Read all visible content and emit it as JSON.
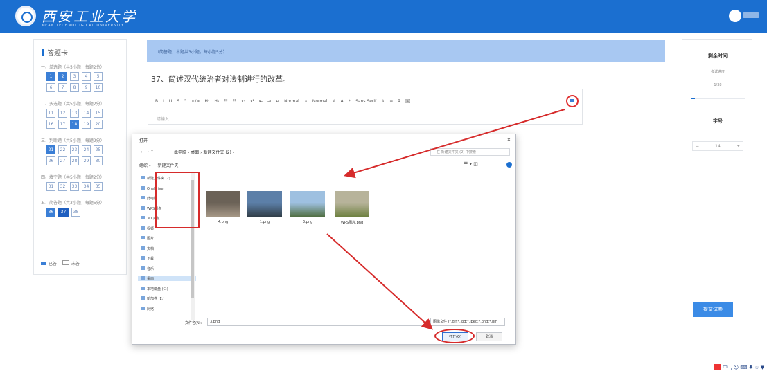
{
  "header": {
    "logo_text": "西安工业大学",
    "logo_sub": "XI'AN TECHNOLOGICAL UNIVERSITY",
    "user_name": ""
  },
  "answer_card": {
    "title": "答题卡",
    "sections": [
      {
        "title": "一、单选题（共5小题，每题2分）",
        "rows": [
          [
            "1",
            "2",
            "3",
            "4",
            "5"
          ],
          [
            "6",
            "7",
            "8",
            "9",
            "10"
          ]
        ],
        "done": [
          "1",
          "2"
        ],
        "current": []
      },
      {
        "title": "二、多选题（共5小题，每题2分）",
        "rows": [
          [
            "11",
            "12",
            "13",
            "14",
            "15"
          ],
          [
            "16",
            "17",
            "18",
            "19",
            "20"
          ]
        ],
        "done": [
          "18"
        ],
        "current": []
      },
      {
        "title": "三、判断题（共5小题，每题2分）",
        "rows": [
          [
            "21",
            "22",
            "23",
            "24",
            "25"
          ],
          [
            "26",
            "27",
            "28",
            "29",
            "30"
          ]
        ],
        "done": [
          "21"
        ],
        "current": []
      },
      {
        "title": "四、填空题（共5小题，每题2分）",
        "rows": [
          [
            "31",
            "32",
            "33",
            "34",
            "35"
          ]
        ],
        "done": [],
        "current": []
      },
      {
        "title": "五、简答题（共3小题，每题5分）",
        "rows": [
          [
            "36",
            "37",
            "38"
          ]
        ],
        "done": [
          "36"
        ],
        "current": [
          "37"
        ]
      }
    ],
    "legend_done": "已答",
    "legend_todo": "未答"
  },
  "main": {
    "banner_text": "（简答题，本题共3小题，每小题5分）",
    "question": "37、简述汉代统治者对法制进行的改革。",
    "toolbar_items": [
      "B",
      "I",
      "U",
      "S",
      "❞",
      "</>",
      "H₁",
      "H₂",
      "☷",
      "☷",
      "x₂",
      "x²",
      "⇤",
      "⇥",
      "↵",
      "Normal",
      "⇕",
      "Normal",
      "⇕",
      "A",
      "⌖",
      "Sans Serif",
      "⇕",
      "≡",
      "T̶",
      "🖼"
    ],
    "editor_placeholder": "请输入"
  },
  "right_panel": {
    "time_title": "剩余时间",
    "time_label": "考试进度",
    "time_value": "1/38",
    "progress_percent": 8,
    "font_title": "字号",
    "font_minus": "−",
    "font_value": "14",
    "font_plus": "+",
    "submit_label": "提交试卷"
  },
  "dialog": {
    "title": "打开",
    "close": "×",
    "nav_arrows": "← → ↑",
    "path": [
      "此电脑",
      "桌面",
      "新建文件夹 (2)"
    ],
    "search_placeholder": "在 新建文件夹 (2) 中搜索",
    "cmd_organize": "组织 ▾",
    "cmd_new_folder": "新建文件夹",
    "cmd_right": "☰ ▾  ◫",
    "nav_items": [
      {
        "label": "新建文件夹 (2)",
        "selected": false
      },
      {
        "label": "OneDrive",
        "selected": false
      },
      {
        "label": "此电脑",
        "selected": false
      },
      {
        "label": "WPS网盘",
        "selected": false
      },
      {
        "label": "3D 对象",
        "selected": false
      },
      {
        "label": "视频",
        "selected": false
      },
      {
        "label": "图片",
        "selected": false
      },
      {
        "label": "文档",
        "selected": false
      },
      {
        "label": "下载",
        "selected": false
      },
      {
        "label": "音乐",
        "selected": false
      },
      {
        "label": "桌面",
        "selected": true
      },
      {
        "label": "本地磁盘 (C:)",
        "selected": false
      },
      {
        "label": "新加卷 (E:)",
        "selected": false
      },
      {
        "label": "网络",
        "selected": false
      }
    ],
    "files": [
      {
        "name": "4.png",
        "colors": [
          "#6b6257",
          "#a89a88"
        ]
      },
      {
        "name": "1.png",
        "colors": [
          "#5c7fa8",
          "#2f3b44"
        ]
      },
      {
        "name": "3.png",
        "colors": [
          "#9ec0e0",
          "#4d6b3a"
        ]
      },
      {
        "name": "WPS图片.png",
        "colors": [
          "#b7b39a",
          "#6b7f3d"
        ]
      }
    ],
    "filename_label": "文件名(N):",
    "filename_value": "3.png",
    "filetype_value": "图像文件 (*.gif;*.jpg;*.jpeg;*.png;*.bm",
    "open_label": "打开(O)",
    "cancel_label": "取消"
  },
  "ime": {
    "text": "中 ·, ☺ ⌨ ♣ ☆ ▼"
  }
}
